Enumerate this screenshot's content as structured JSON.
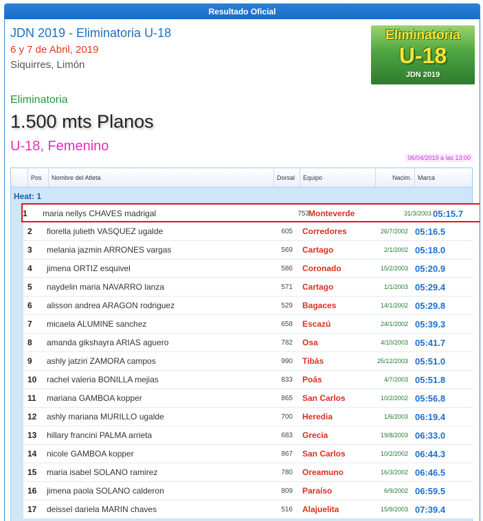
{
  "header": {
    "title": "Resultado Oficial"
  },
  "event": {
    "title": "JDN 2019 - Eliminatoria U-18",
    "date": "6 y 7 de Abril, 2019",
    "place": "Siquirres, Limón"
  },
  "logo": {
    "line1": "Eliminatoria",
    "line2": "U-18",
    "line3": "JDN 2019"
  },
  "race": {
    "section": "Eliminatoria",
    "name": "1.500 mts Planos",
    "category": "U-18, Femenino",
    "timestamp": "06/04/2019 a las 13:00"
  },
  "table": {
    "columns": {
      "pos": "Pos",
      "name": "Nombre del Atleta",
      "bib": "Dorsal",
      "team": "Equipo",
      "birth": "Nacim.",
      "mark": "Marca"
    },
    "heat": "Heat: 1",
    "rows": [
      {
        "pos": "1",
        "name": "maria nellys CHAVES madrigal",
        "bib": "753",
        "team": "Monteverde",
        "birth": "31/3/2003",
        "mark": "05:15.7"
      },
      {
        "pos": "2",
        "name": "fiorella julieth VASQUEZ ugalde",
        "bib": "605",
        "team": "Corredores",
        "birth": "26/7/2002",
        "mark": "05:16.5"
      },
      {
        "pos": "3",
        "name": "melania jazmin ARRONES vargas",
        "bib": "569",
        "team": "Cartago",
        "birth": "2/1/2002",
        "mark": "05:18.0"
      },
      {
        "pos": "4",
        "name": "jimena ORTIZ esquivel",
        "bib": "586",
        "team": "Coronado",
        "birth": "15/2/2003",
        "mark": "05:20.9"
      },
      {
        "pos": "5",
        "name": "naydelin maria NAVARRO lanza",
        "bib": "571",
        "team": "Cartago",
        "birth": "1/1/2003",
        "mark": "05:29.4"
      },
      {
        "pos": "6",
        "name": "alisson andrea ARAGON rodriguez",
        "bib": "529",
        "team": "Bagaces",
        "birth": "14/1/2002",
        "mark": "05:29.8"
      },
      {
        "pos": "7",
        "name": "micaela ALUMINE sanchez",
        "bib": "658",
        "team": "Escazú",
        "birth": "24/1/2002",
        "mark": "05:39.3"
      },
      {
        "pos": "8",
        "name": "amanda gikshayra ARIAS aguero",
        "bib": "782",
        "team": "Osa",
        "birth": "4/10/2003",
        "mark": "05:41.7"
      },
      {
        "pos": "9",
        "name": "ashly jatziri ZAMORA campos",
        "bib": "990",
        "team": "Tibás",
        "birth": "25/12/2003",
        "mark": "05:51.0"
      },
      {
        "pos": "10",
        "name": "rachel valeria BONILLA mejias",
        "bib": "833",
        "team": "Poás",
        "birth": "4/7/2003",
        "mark": "05:51.8"
      },
      {
        "pos": "11",
        "name": "mariana GAMBOA kopper",
        "bib": "865",
        "team": "San Carlos",
        "birth": "10/2/2002",
        "mark": "05:56.8"
      },
      {
        "pos": "12",
        "name": "ashly mariana MURILLO ugalde",
        "bib": "700",
        "team": "Heredia",
        "birth": "1/6/2003",
        "mark": "06:19.4"
      },
      {
        "pos": "13",
        "name": "hillary francini PALMA arrieta",
        "bib": "683",
        "team": "Grecia",
        "birth": "19/8/2003",
        "mark": "06:33.0"
      },
      {
        "pos": "14",
        "name": "nicole GAMBOA kopper",
        "bib": "867",
        "team": "San Carlos",
        "birth": "10/2/2002",
        "mark": "06:44.3"
      },
      {
        "pos": "15",
        "name": "maria isabel SOLANO ramirez",
        "bib": "780",
        "team": "Oreamuno",
        "birth": "16/3/2002",
        "mark": "06:46.5"
      },
      {
        "pos": "16",
        "name": "jimena paola SOLANO calderon",
        "bib": "809",
        "team": "Paraíso",
        "birth": "6/9/2002",
        "mark": "06:59.5"
      },
      {
        "pos": "17",
        "name": "deissel dariela MARIN chaves",
        "bib": "516",
        "team": "Alajuelita",
        "birth": "15/9/2003",
        "mark": "07:39.4"
      }
    ]
  }
}
